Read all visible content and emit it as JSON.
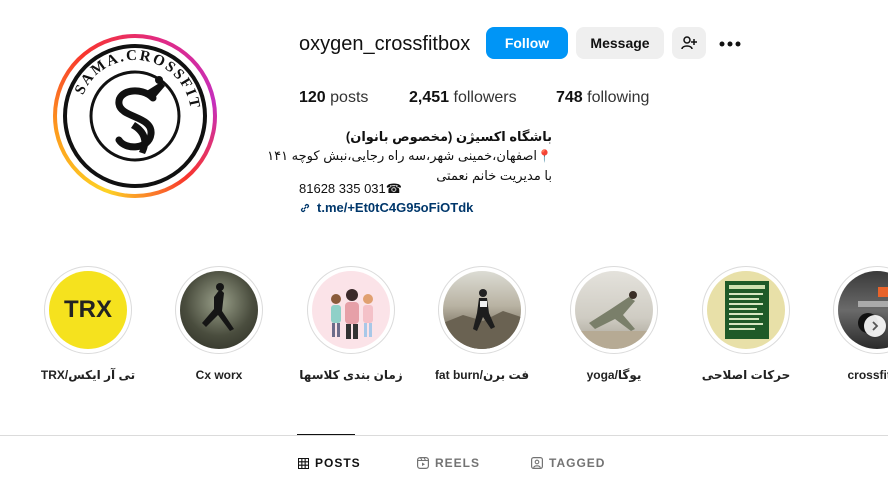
{
  "profile": {
    "username": "oxygen_crossfitbox",
    "logo_text": "SAMA.CROSSFIT"
  },
  "actions": {
    "follow": "Follow",
    "message": "Message",
    "suggest_icon": "person-add-icon",
    "more_icon": "more-horizontal-icon"
  },
  "stats": {
    "posts_count": "120",
    "posts_label": "posts",
    "followers_count": "2,451",
    "followers_label": "followers",
    "following_count": "748",
    "following_label": "following"
  },
  "bio": {
    "name": "باشگاه اکسیژن (مخصوص بانوان)",
    "address": "اصفهان،خمینی شهر،سه راه رجایی،نبش کوچه ۱۴۱",
    "manager": "با مدیریت خانم نعمتی",
    "phone": "81628 335 031☎",
    "link": "t.me/+Et0tC4G95oFiOTdk"
  },
  "highlights": [
    {
      "label": "TRX/تی آر ایکس",
      "thumb": "TRX"
    },
    {
      "label": "Cx worx"
    },
    {
      "label": "زمان بندی کلاسها"
    },
    {
      "label": "fat burn/فت برن"
    },
    {
      "label": "yoga/یوگا"
    },
    {
      "label": "حرکات اصلاحی"
    },
    {
      "label": "crossfit/ک"
    }
  ],
  "tabs": {
    "posts": "POSTS",
    "reels": "REELS",
    "tagged": "TAGGED"
  },
  "colors": {
    "follow_button": "#0095f6",
    "secondary_button": "#efefef",
    "link": "#00376b"
  }
}
